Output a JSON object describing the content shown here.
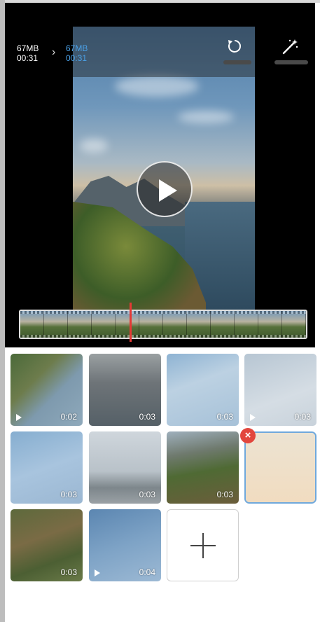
{
  "editor": {
    "original_size": "67MB",
    "original_duration": "00:31",
    "new_size": "67MB",
    "new_duration": "00:31"
  },
  "toolbar": {
    "undo_icon": "undo-icon",
    "magic_icon": "magic-wand-icon"
  },
  "clips": [
    {
      "duration": "0:02",
      "type": "video"
    },
    {
      "duration": "0:03",
      "type": "photo"
    },
    {
      "duration": "0:03",
      "type": "photo"
    },
    {
      "duration": "0:03",
      "type": "video"
    },
    {
      "duration": "0:03",
      "type": "photo"
    },
    {
      "duration": "0:03",
      "type": "photo"
    },
    {
      "duration": "0:03",
      "type": "photo"
    },
    {
      "duration": "",
      "type": "photo"
    },
    {
      "duration": "0:03",
      "type": "photo"
    },
    {
      "duration": "0:04",
      "type": "video"
    }
  ],
  "colors": {
    "accent": "#4aa0e6",
    "playhead": "#e53935",
    "remove": "#e2463d"
  }
}
